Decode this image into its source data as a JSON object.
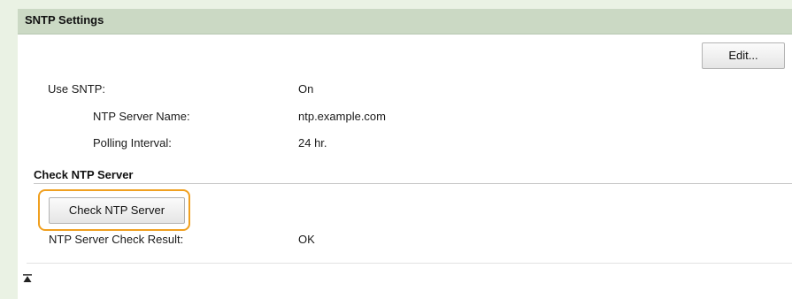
{
  "header": {
    "title": "SNTP Settings"
  },
  "toolbar": {
    "edit_label": "Edit..."
  },
  "sntp": {
    "use_sntp_label": "Use SNTP:",
    "use_sntp_value": "On",
    "server_name_label": "NTP Server Name:",
    "server_name_value": "ntp.example.com",
    "polling_interval_label": "Polling Interval:",
    "polling_interval_value": "24 hr."
  },
  "check": {
    "section_title": "Check NTP Server",
    "button_label": "Check NTP Server",
    "result_label": "NTP Server Check Result:",
    "result_value": "OK"
  },
  "footer": {
    "top_icon": "back-to-top-icon"
  },
  "colors": {
    "header_bg": "#cbd9c4",
    "focus_outline": "#f0a020"
  }
}
